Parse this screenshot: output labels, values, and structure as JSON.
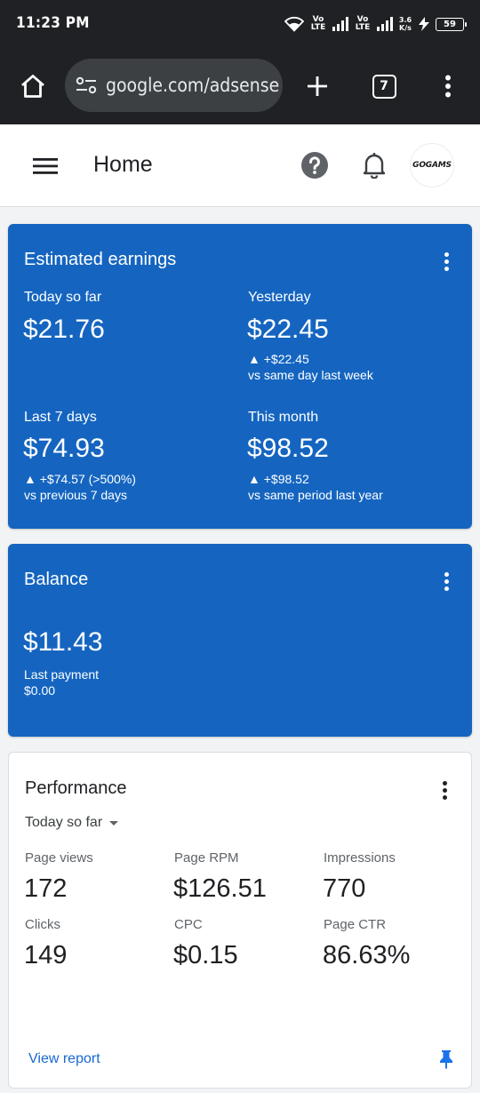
{
  "status_bar": {
    "time": "11:23 PM",
    "sim1_label": "Vo LTE",
    "sim2_label": "Vo LTE",
    "net_speed": "3.6 K/s",
    "battery": "59"
  },
  "browser": {
    "url": "google.com/adsense",
    "tab_count": "7"
  },
  "app_header": {
    "title": "Home",
    "avatar_text": "GOGAMS"
  },
  "earnings": {
    "title": "Estimated earnings",
    "today": {
      "label": "Today so far",
      "value": "$21.76"
    },
    "yesterday": {
      "label": "Yesterday",
      "value": "$22.45",
      "delta": "▲ +$22.45",
      "compare": "vs same day last week"
    },
    "last7": {
      "label": "Last 7 days",
      "value": "$74.93",
      "delta": "▲ +$74.57 (>500%)",
      "compare": "vs previous 7 days"
    },
    "month": {
      "label": "This month",
      "value": "$98.52",
      "delta": "▲ +$98.52",
      "compare": "vs same period last year"
    }
  },
  "balance": {
    "title": "Balance",
    "value": "$11.43",
    "last_payment_label": "Last payment",
    "last_payment_value": "$0.00"
  },
  "performance": {
    "title": "Performance",
    "range": "Today so far",
    "metrics": [
      {
        "label": "Page views",
        "value": "172"
      },
      {
        "label": "Page RPM",
        "value": "$126.51"
      },
      {
        "label": "Impressions",
        "value": "770"
      },
      {
        "label": "Clicks",
        "value": "149"
      },
      {
        "label": "CPC",
        "value": "$0.15"
      },
      {
        "label": "Page CTR",
        "value": "86.63%"
      }
    ],
    "view_report": "View report"
  },
  "colors": {
    "card_blue": "#1565c0",
    "link_blue": "#1967d2",
    "browser_dark": "#202124"
  }
}
